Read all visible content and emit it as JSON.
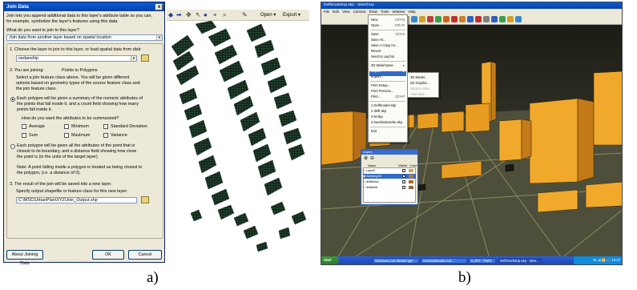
{
  "dialog": {
    "title": "Join Data",
    "close": "x",
    "intro": [
      "Join lets you append additional data to this layer's attribute table so you can,",
      "for example, symbolize the layer's features using this data."
    ],
    "question": "What do you want to join to this layer?",
    "join_type": "Join data from another layer based on spatial location",
    "step1": "1.  Choose the layer to join to this layer, or load spatial data from disk:",
    "layer": "nedanship",
    "step2_prefix": "2.  You are joining:",
    "step2_value": "Points to Polygons",
    "step2_text": [
      "Select a join feature class above. You will be given different",
      "options based on geometry types of the source feature class and",
      "the join feature class."
    ],
    "option1": [
      "Each polygon will be given a summary of the numeric attributes of",
      "the points that fall inside it, and a count field showing how many",
      "points fall inside it."
    ],
    "summarize_q": "How do you want the attributes to be summarized?",
    "checks": [
      "Average",
      "Minimum",
      "Standard Deviation",
      "Sum",
      "Maximum",
      "Variance"
    ],
    "option2": [
      "Each polygon will be given all the attributes of the point that is",
      "closest to its boundary, and a distance field showing how close",
      "the point is (in the units of the target layer)."
    ],
    "note": [
      "Note: A point falling inside a polygon is treated as being closest to",
      "the polygon, (i.e. a distance of 0)."
    ],
    "step3": [
      "3.  The result of the join will be saved into a new layer.",
      "Specify output shapefile or feature class for this new layer:"
    ],
    "output_path": "C:\\MSC\\UrbanPlan\\XYZ\\Join_Output.shp",
    "about_button": "About Joining Data",
    "ok_button": "OK",
    "cancel_button": "Cancel"
  },
  "toolbar_a": {
    "open_label": "Open ▾",
    "export_label": "Export ▾"
  },
  "sketchup": {
    "title": "DelftmodelUp.skp - SketchUp",
    "menus": [
      "File",
      "Edit",
      "View",
      "Camera",
      "Draw",
      "Tools",
      "Window",
      "Help"
    ],
    "file_menu": [
      {
        "label": "New",
        "shortcut": "Ctrl+N"
      },
      {
        "label": "Open...",
        "shortcut": "Ctrl+O"
      },
      {
        "label": "Save",
        "shortcut": "Ctrl+S"
      },
      {
        "label": "Save As...",
        "shortcut": ""
      },
      {
        "label": "Save A Copy As...",
        "shortcut": ""
      },
      {
        "label": "Revert",
        "shortcut": ""
      },
      {
        "label": "Send to LayOut",
        "shortcut": ""
      },
      {
        "label": "3D Warehouse",
        "shortcut": "▸"
      },
      {
        "label": "Export",
        "shortcut": "▸"
      },
      {
        "label": "Import...",
        "shortcut": ""
      },
      {
        "label": "Print Setup...",
        "shortcut": ""
      },
      {
        "label": "Print Preview...",
        "shortcut": ""
      },
      {
        "label": "Print...",
        "shortcut": "Ctrl+P"
      },
      {
        "label": "1 Delftmodel.skp",
        "shortcut": ""
      },
      {
        "label": "2 delft.skp",
        "shortcut": ""
      },
      {
        "label": "3 M.skp",
        "shortcut": ""
      },
      {
        "label": "4 buurtindeverbe.skp",
        "shortcut": ""
      },
      {
        "label": "Exit",
        "shortcut": ""
      }
    ],
    "export_submenu": [
      "3D Model...",
      "2D Graphic...",
      "Section Slice...",
      "Animation..."
    ],
    "layers_panel": {
      "title": "Layers",
      "columns": [
        "Name",
        "Visible",
        "Color"
      ],
      "rows": [
        {
          "name": "Layer0",
          "color": "#d9a24a"
        },
        {
          "name": "Building3D",
          "color": "#c27a2c"
        },
        {
          "name": "delftsblnc",
          "color": "#b06a20"
        },
        {
          "name": "delftstrdl",
          "color": "#8a6a3a"
        }
      ]
    },
    "taskbar": {
      "start": "Start",
      "tasks": [
        "Windows Live Messenger",
        "ramsainbandel.xcd...",
        "5.JPG - Paint",
        "DelftmodelUp.skp - Sket..."
      ],
      "tray": "NL ◀ 📶 🔊 10:27"
    }
  },
  "captions": {
    "a": "a)",
    "b": "b)"
  }
}
